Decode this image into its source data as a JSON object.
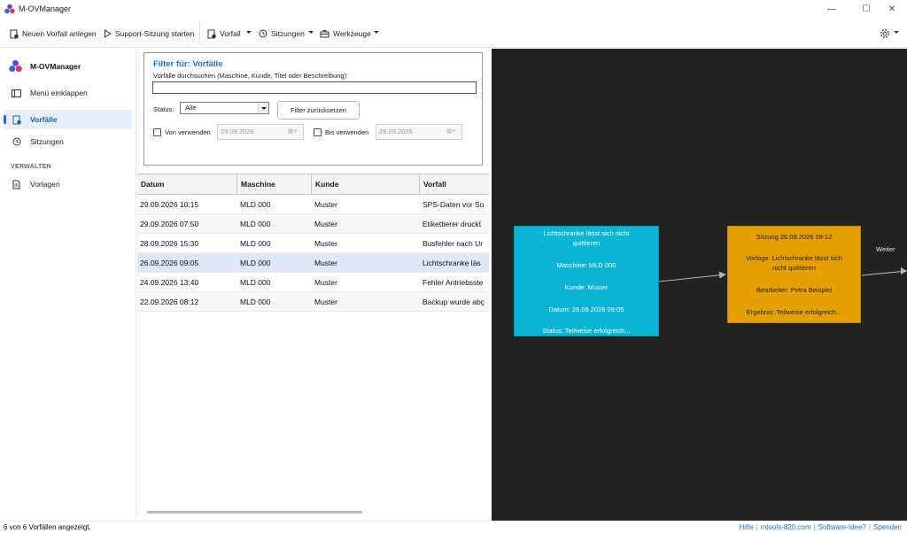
{
  "window": {
    "title": "M-OVManager",
    "controls": [
      "—",
      "☐",
      "✕"
    ]
  },
  "toolbar": {
    "new_incident": "Neuen Vorfall anlegen",
    "start_support": "Support-Sitzung starten",
    "incident_menu": "Vorfall",
    "sessions_menu": "Sitzungen",
    "tools_menu": "Werkzeuge",
    "settings_icon": "gear-icon"
  },
  "sidebar": {
    "brand": "M-OVManager",
    "collapse": "Menü einklappen",
    "items": [
      {
        "label": "Vorfälle",
        "icon": "incident-icon",
        "active": true
      },
      {
        "label": "Sitzungen",
        "icon": "history-icon",
        "active": false
      }
    ],
    "section": "VERWALTEN",
    "manage_items": [
      {
        "label": "Vorlagen",
        "icon": "document-icon"
      }
    ]
  },
  "filter": {
    "title": "Filter für: Vorfälle",
    "search_label": "Vorfälle durchsuchen (Maschine, Kunde, Titel oder Beschreibung):",
    "search_value": "",
    "status_label": "Status:",
    "status_value": "Alle",
    "reset_label": "Filter zurücksetzen",
    "from_label": "Von verwenden",
    "from_date": "29.09.2026",
    "to_label": "Bis verwenden",
    "to_date": "29.09.2026"
  },
  "table": {
    "columns": [
      "Datum",
      "Maschine",
      "Kunde",
      "Vorfall"
    ],
    "rows": [
      [
        "29.09.2026 10:15",
        "MLD 000",
        "Muster",
        "SPS-Daten vor So"
      ],
      [
        "29.09.2026 07:50",
        "MLD 000",
        "Muster",
        "Etikettierer druckt"
      ],
      [
        "28.09.2026 15:30",
        "MLD 000",
        "Muster",
        "Busfehler nach Ur"
      ],
      [
        "26.09.2026 09:05",
        "MLD 000",
        "Muster",
        "Lichtschranke läs"
      ],
      [
        "24.09.2026 13:40",
        "MLD 000",
        "Muster",
        "Fehler Antriebsste"
      ],
      [
        "22.09.2026 08:12",
        "MLD 000",
        "Muster",
        "Backup wurde abç"
      ]
    ],
    "selected_row": 3
  },
  "canvas": {
    "incident_node": {
      "title_line1": "Lichtschranke lässt sich nicht",
      "title_line2": "quittieren",
      "machine": "Maschine: MLD 000",
      "customer": "Kunde: Muster",
      "date": "Datum: 26.09.2026 09:05",
      "status": "Status:  Teilweise  erfolgreich..."
    },
    "session_node": {
      "title": "Sitzung 26.09.2026 09:12",
      "template_line1": "Vorlage: Lichtschranke lässt sich",
      "template_line2": "nicht quittieren",
      "editor": "Bearbeiter: Petra Beispiel",
      "result": "Ergebnis:  Teilweise  erfolgreich..."
    },
    "next_label": "Weiter",
    "colors": {
      "incident": "#0ab4d6",
      "session": "#e5a000",
      "background": "#222222"
    }
  },
  "statusbar": {
    "count_text": "6 von 6 Vorfällen angezeigt.",
    "links": [
      "Hilfe",
      "mtools-820.com",
      "Software-Idee?",
      "Spenden"
    ]
  }
}
